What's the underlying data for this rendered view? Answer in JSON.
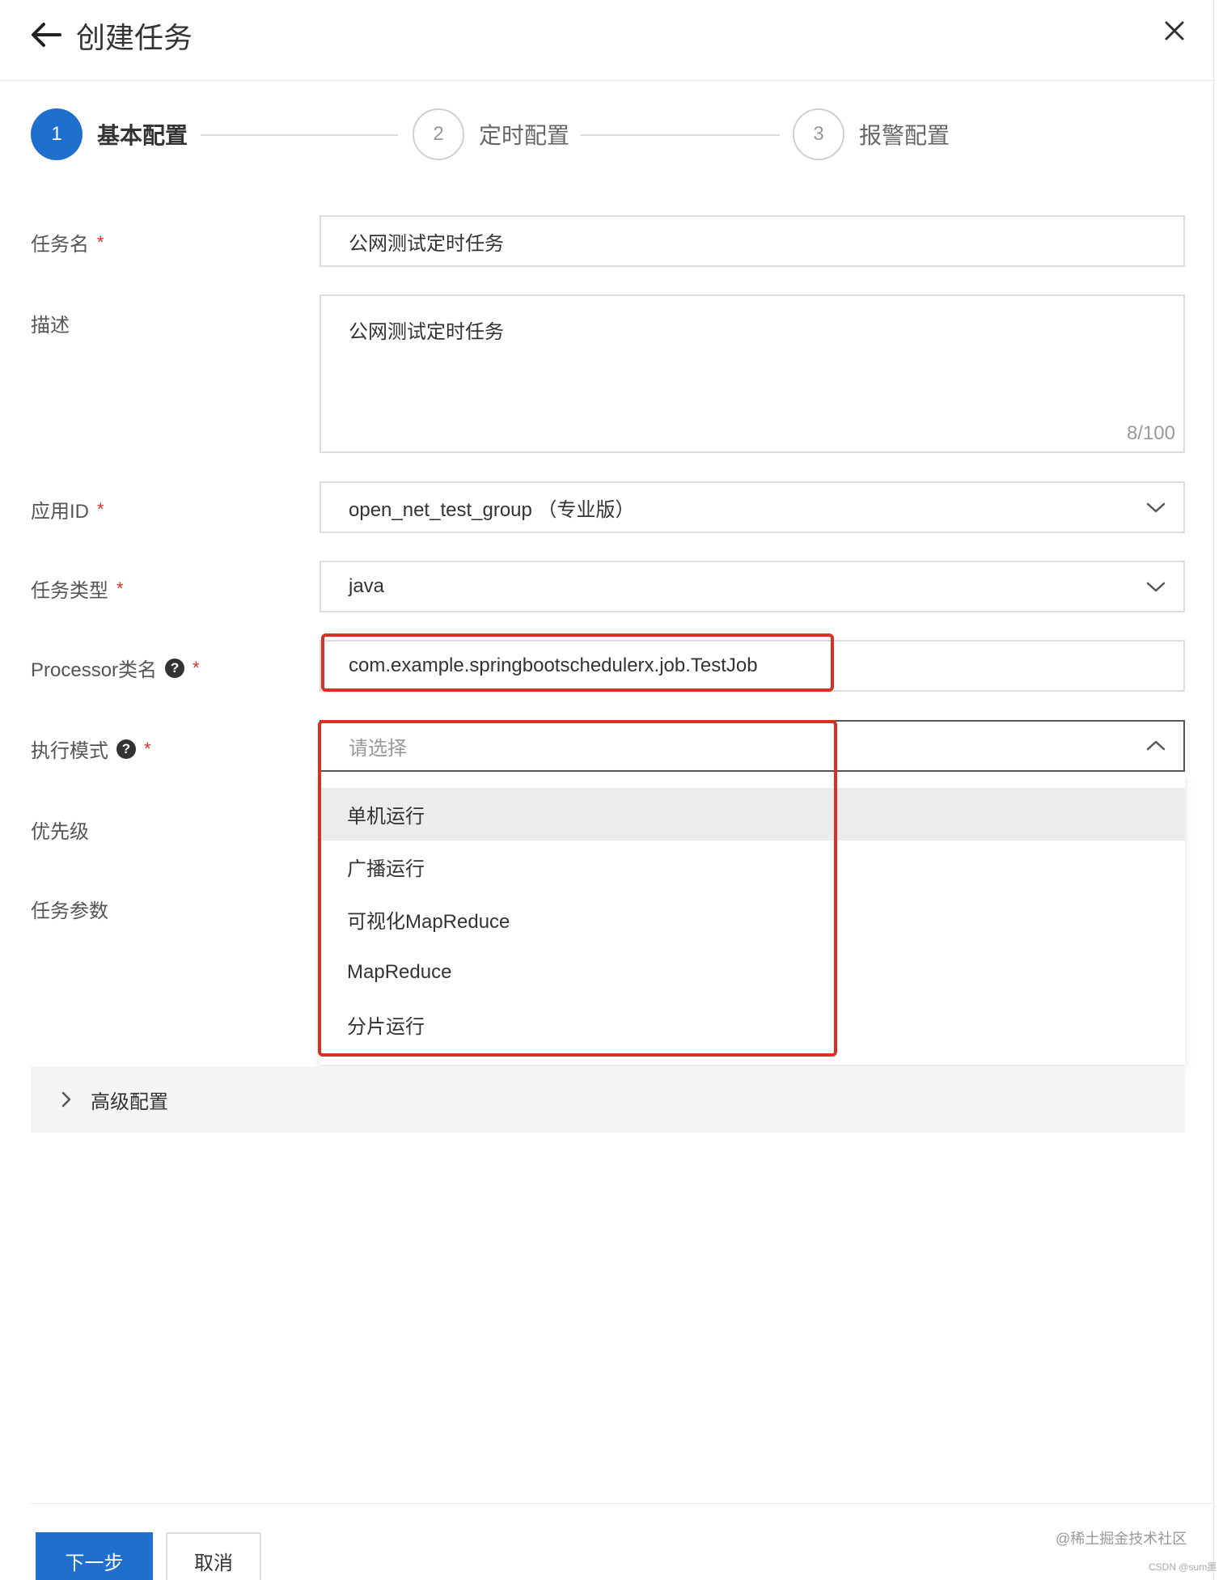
{
  "header": {
    "title": "创建任务",
    "back_icon": "arrow-left-icon",
    "close_icon": "close-icon"
  },
  "steps": [
    {
      "number": "1",
      "label": "基本配置",
      "state": "active"
    },
    {
      "number": "2",
      "label": "定时配置",
      "state": "inactive"
    },
    {
      "number": "3",
      "label": "报警配置",
      "state": "inactive"
    }
  ],
  "form": {
    "task_name": {
      "label": "任务名",
      "required": "*",
      "value": "公网测试定时任务"
    },
    "description": {
      "label": "描述",
      "value": "公网测试定时任务",
      "counter": "8/100"
    },
    "app_id": {
      "label": "应用ID",
      "required": "*",
      "value": "open_net_test_group （专业版）"
    },
    "task_type": {
      "label": "任务类型",
      "required": "*",
      "value": "java"
    },
    "processor": {
      "label": "Processor类名",
      "required": "*",
      "value": "com.example.springbootschedulerx.job.TestJob"
    },
    "exec_mode": {
      "label": "执行模式",
      "required": "*",
      "placeholder": "请选择"
    },
    "priority": {
      "label": "优先级"
    },
    "task_params": {
      "label": "任务参数"
    }
  },
  "dropdown": {
    "options": [
      "单机运行",
      "广播运行",
      "可视化MapReduce",
      "MapReduce",
      "分片运行"
    ],
    "hovered_index": 0
  },
  "advanced": {
    "label": "高级配置"
  },
  "footer": {
    "next_label": "下一步",
    "cancel_label": "取消"
  },
  "watermark": {
    "text": "@稀土掘金技术社区",
    "small_text": "CSDN @sum墨"
  },
  "colors": {
    "primary": "#1f6fcf",
    "required": "#d93026",
    "annotation": "#d93026"
  }
}
